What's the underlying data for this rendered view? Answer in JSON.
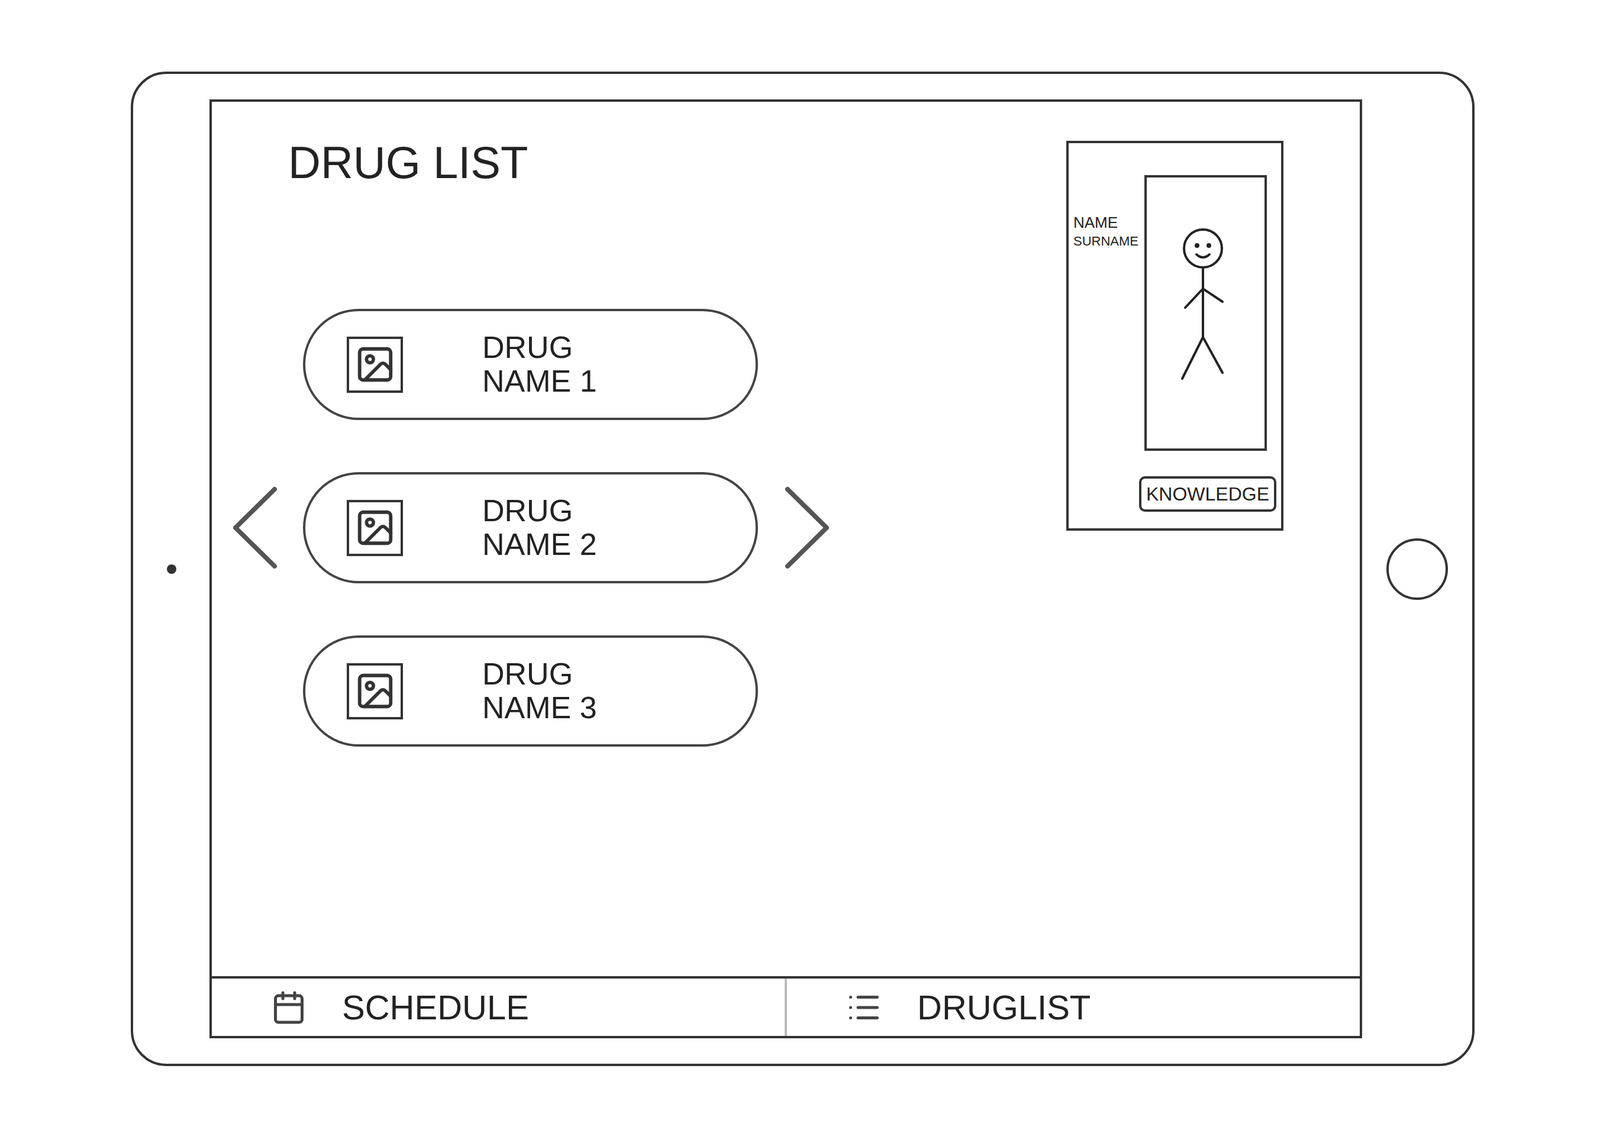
{
  "page": {
    "title": "DRUG LIST"
  },
  "drugs": [
    {
      "lines": [
        "DRUG",
        "NAME 1"
      ]
    },
    {
      "lines": [
        "DRUG",
        "NAME 2"
      ]
    },
    {
      "lines": [
        "DRUG",
        "NAME 3"
      ]
    }
  ],
  "profile": {
    "name": "NAME",
    "surname": "SURNAME",
    "button": "KNOWLEDGE"
  },
  "tabs": [
    {
      "label": "SCHEDULE",
      "icon": "calendar"
    },
    {
      "label": "DRUGLIST",
      "icon": "list"
    }
  ]
}
